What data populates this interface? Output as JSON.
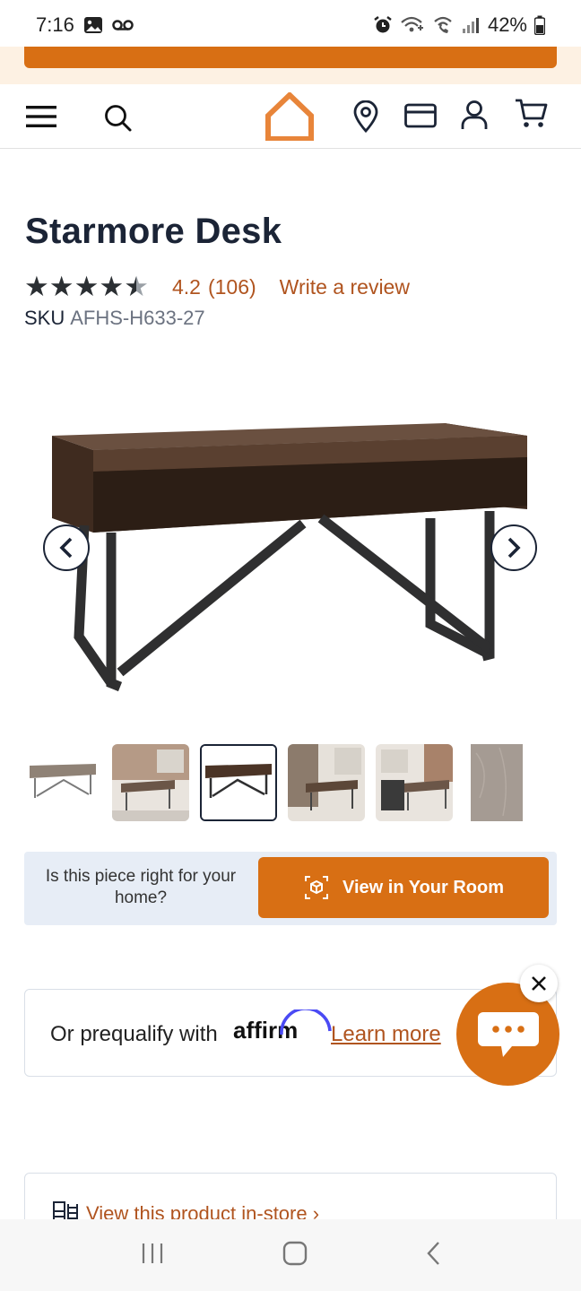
{
  "status_bar": {
    "time": "7:16",
    "battery": "42%"
  },
  "header": {
    "menu_icon": "hamburger-icon",
    "search_icon": "search-icon",
    "logo_icon": "house-logo-icon",
    "location_icon": "map-pin-icon",
    "card_icon": "credit-card-icon",
    "account_icon": "user-icon",
    "cart_icon": "cart-icon"
  },
  "product": {
    "title": "Starmore Desk",
    "rating": "4.2",
    "review_count": "(106)",
    "write_review": "Write a review",
    "sku_label": "SKU",
    "sku_value": "AFHS-H633-27",
    "stars_value": 4.2
  },
  "room": {
    "question": "Is this piece right for your home?",
    "button_label": "View in Your Room"
  },
  "affirm": {
    "text": "Or prequalify with",
    "brand": "affirm",
    "link": "Learn more"
  },
  "instore": {
    "link": "View this product in-store ›"
  },
  "colors": {
    "accent": "#d86f14",
    "link": "#b0541f",
    "title": "#1b2436",
    "room_bg": "#e7edf6"
  }
}
